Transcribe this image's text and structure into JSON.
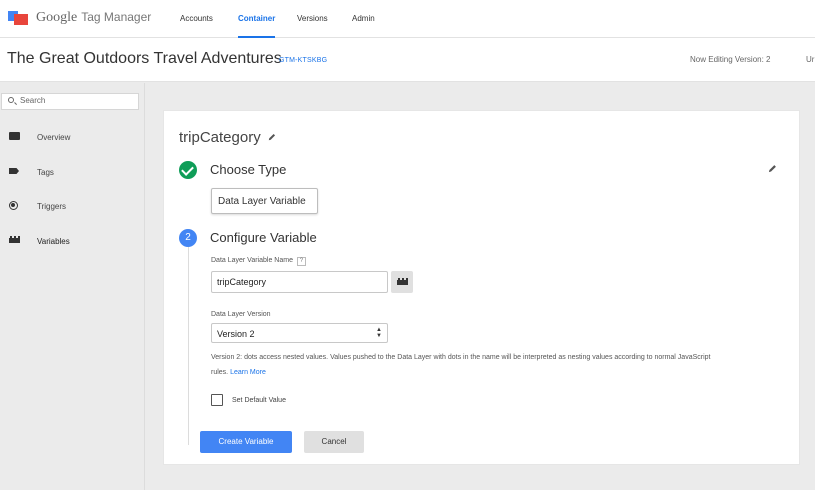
{
  "app": {
    "name": "Google",
    "product": "Tag Manager",
    "logo_icon": "gtm-logo-icon"
  },
  "nav": {
    "tabs": [
      {
        "label": "Accounts",
        "active": false
      },
      {
        "label": "Container",
        "active": true
      },
      {
        "label": "Versions",
        "active": false
      },
      {
        "label": "Admin",
        "active": false
      }
    ]
  },
  "header": {
    "title": "The Great Outdoors Travel Adventures",
    "container_id": "GTM-KTSKBG",
    "editing_version": "Now Editing Version: 2",
    "truncated_status": "Ur"
  },
  "sidebar": {
    "search_placeholder": "Search",
    "items": [
      {
        "label": "Overview",
        "icon": "overview-icon"
      },
      {
        "label": "Tags",
        "icon": "tag-icon"
      },
      {
        "label": "Triggers",
        "icon": "trigger-icon"
      },
      {
        "label": "Variables",
        "icon": "variables-icon",
        "active": true
      }
    ]
  },
  "editor": {
    "variable_name": "tripCategory",
    "step1": {
      "title": "Choose Type",
      "selected_type": "Data Layer Variable"
    },
    "step2": {
      "number": "2",
      "title": "Configure Variable",
      "dlv_name_label": "Data Layer Variable Name",
      "help_icon": "?",
      "dlv_name_value": "tripCategory",
      "version_label": "Data Layer Version",
      "version_value": "Version 2",
      "version_help_line1": "Version 2: dots access nested values. Values pushed to the Data Layer with dots in the name will be interpreted as nesting values according to normal JavaScript",
      "version_help_line2": "rules.",
      "learn_more": "Learn More",
      "default_value_label": "Set Default Value",
      "default_value_checked": false
    },
    "create_button": "Create Variable",
    "cancel_button": "Cancel"
  },
  "colors": {
    "accent": "#4285f4",
    "link": "#1a73e8",
    "success": "#0f9d58"
  }
}
